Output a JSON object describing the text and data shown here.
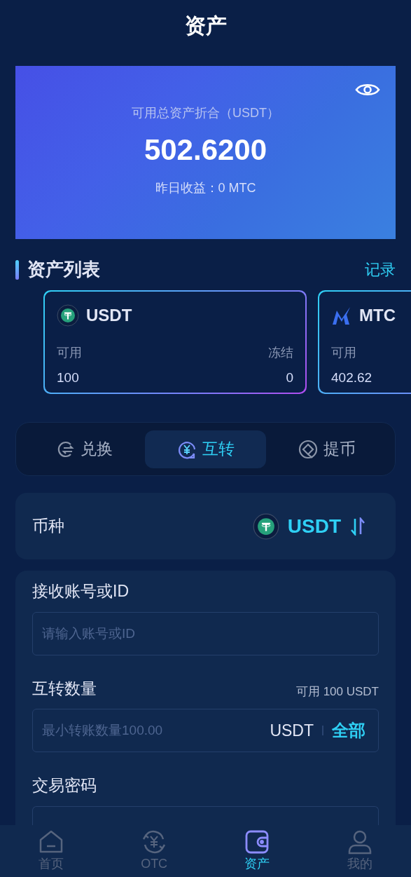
{
  "header": {
    "title": "资产"
  },
  "summary": {
    "label": "可用总资产折合（USDT）",
    "total": "502.6200",
    "yesterday": "昨日收益：0 MTC"
  },
  "asset_list": {
    "title": "资产列表",
    "link": "记录",
    "cards": [
      {
        "kind": "usdt",
        "name": "USDT",
        "available_label": "可用",
        "available": "100",
        "frozen_label": "冻结",
        "frozen": "0"
      },
      {
        "kind": "mtc",
        "name": "MTC",
        "available_label": "可用",
        "available": "402.62"
      }
    ]
  },
  "actions": [
    {
      "kind": "exchange",
      "label": "兑换",
      "selected": false
    },
    {
      "kind": "transfer",
      "label": "互转",
      "selected": true
    },
    {
      "kind": "withdraw",
      "label": "提币",
      "selected": false
    }
  ],
  "coin": {
    "label": "币种",
    "value": "USDT"
  },
  "form": {
    "recipient": {
      "label": "接收账号或ID",
      "placeholder": "请输入账号或ID"
    },
    "amount": {
      "label": "互转数量",
      "available": "可用 100 USDT",
      "placeholder": "最小转账数量100.00",
      "unit": "USDT",
      "all": "全部"
    },
    "password": {
      "label": "交易密码"
    }
  },
  "nav": [
    {
      "kind": "home",
      "label": "首页",
      "selected": false
    },
    {
      "kind": "otc",
      "label": "OTC",
      "selected": false
    },
    {
      "kind": "assets",
      "label": "资产",
      "selected": true
    },
    {
      "kind": "me",
      "label": "我的",
      "selected": false
    }
  ]
}
